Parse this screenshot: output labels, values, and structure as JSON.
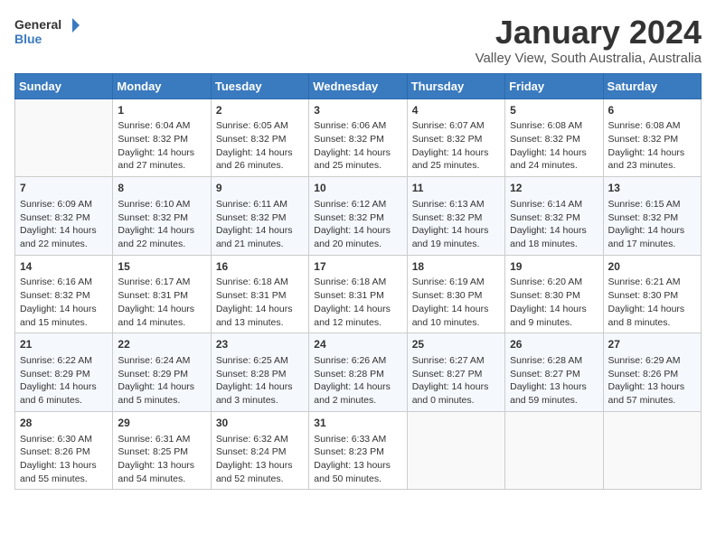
{
  "header": {
    "logo_line1": "General",
    "logo_line2": "Blue",
    "title": "January 2024",
    "subtitle": "Valley View, South Australia, Australia"
  },
  "days_of_week": [
    "Sunday",
    "Monday",
    "Tuesday",
    "Wednesday",
    "Thursday",
    "Friday",
    "Saturday"
  ],
  "weeks": [
    [
      {
        "day": "",
        "info": ""
      },
      {
        "day": "1",
        "info": "Sunrise: 6:04 AM\nSunset: 8:32 PM\nDaylight: 14 hours\nand 27 minutes."
      },
      {
        "day": "2",
        "info": "Sunrise: 6:05 AM\nSunset: 8:32 PM\nDaylight: 14 hours\nand 26 minutes."
      },
      {
        "day": "3",
        "info": "Sunrise: 6:06 AM\nSunset: 8:32 PM\nDaylight: 14 hours\nand 25 minutes."
      },
      {
        "day": "4",
        "info": "Sunrise: 6:07 AM\nSunset: 8:32 PM\nDaylight: 14 hours\nand 25 minutes."
      },
      {
        "day": "5",
        "info": "Sunrise: 6:08 AM\nSunset: 8:32 PM\nDaylight: 14 hours\nand 24 minutes."
      },
      {
        "day": "6",
        "info": "Sunrise: 6:08 AM\nSunset: 8:32 PM\nDaylight: 14 hours\nand 23 minutes."
      }
    ],
    [
      {
        "day": "7",
        "info": "Sunrise: 6:09 AM\nSunset: 8:32 PM\nDaylight: 14 hours\nand 22 minutes."
      },
      {
        "day": "8",
        "info": "Sunrise: 6:10 AM\nSunset: 8:32 PM\nDaylight: 14 hours\nand 22 minutes."
      },
      {
        "day": "9",
        "info": "Sunrise: 6:11 AM\nSunset: 8:32 PM\nDaylight: 14 hours\nand 21 minutes."
      },
      {
        "day": "10",
        "info": "Sunrise: 6:12 AM\nSunset: 8:32 PM\nDaylight: 14 hours\nand 20 minutes."
      },
      {
        "day": "11",
        "info": "Sunrise: 6:13 AM\nSunset: 8:32 PM\nDaylight: 14 hours\nand 19 minutes."
      },
      {
        "day": "12",
        "info": "Sunrise: 6:14 AM\nSunset: 8:32 PM\nDaylight: 14 hours\nand 18 minutes."
      },
      {
        "day": "13",
        "info": "Sunrise: 6:15 AM\nSunset: 8:32 PM\nDaylight: 14 hours\nand 17 minutes."
      }
    ],
    [
      {
        "day": "14",
        "info": "Sunrise: 6:16 AM\nSunset: 8:32 PM\nDaylight: 14 hours\nand 15 minutes."
      },
      {
        "day": "15",
        "info": "Sunrise: 6:17 AM\nSunset: 8:31 PM\nDaylight: 14 hours\nand 14 minutes."
      },
      {
        "day": "16",
        "info": "Sunrise: 6:18 AM\nSunset: 8:31 PM\nDaylight: 14 hours\nand 13 minutes."
      },
      {
        "day": "17",
        "info": "Sunrise: 6:18 AM\nSunset: 8:31 PM\nDaylight: 14 hours\nand 12 minutes."
      },
      {
        "day": "18",
        "info": "Sunrise: 6:19 AM\nSunset: 8:30 PM\nDaylight: 14 hours\nand 10 minutes."
      },
      {
        "day": "19",
        "info": "Sunrise: 6:20 AM\nSunset: 8:30 PM\nDaylight: 14 hours\nand 9 minutes."
      },
      {
        "day": "20",
        "info": "Sunrise: 6:21 AM\nSunset: 8:30 PM\nDaylight: 14 hours\nand 8 minutes."
      }
    ],
    [
      {
        "day": "21",
        "info": "Sunrise: 6:22 AM\nSunset: 8:29 PM\nDaylight: 14 hours\nand 6 minutes."
      },
      {
        "day": "22",
        "info": "Sunrise: 6:24 AM\nSunset: 8:29 PM\nDaylight: 14 hours\nand 5 minutes."
      },
      {
        "day": "23",
        "info": "Sunrise: 6:25 AM\nSunset: 8:28 PM\nDaylight: 14 hours\nand 3 minutes."
      },
      {
        "day": "24",
        "info": "Sunrise: 6:26 AM\nSunset: 8:28 PM\nDaylight: 14 hours\nand 2 minutes."
      },
      {
        "day": "25",
        "info": "Sunrise: 6:27 AM\nSunset: 8:27 PM\nDaylight: 14 hours\nand 0 minutes."
      },
      {
        "day": "26",
        "info": "Sunrise: 6:28 AM\nSunset: 8:27 PM\nDaylight: 13 hours\nand 59 minutes."
      },
      {
        "day": "27",
        "info": "Sunrise: 6:29 AM\nSunset: 8:26 PM\nDaylight: 13 hours\nand 57 minutes."
      }
    ],
    [
      {
        "day": "28",
        "info": "Sunrise: 6:30 AM\nSunset: 8:26 PM\nDaylight: 13 hours\nand 55 minutes."
      },
      {
        "day": "29",
        "info": "Sunrise: 6:31 AM\nSunset: 8:25 PM\nDaylight: 13 hours\nand 54 minutes."
      },
      {
        "day": "30",
        "info": "Sunrise: 6:32 AM\nSunset: 8:24 PM\nDaylight: 13 hours\nand 52 minutes."
      },
      {
        "day": "31",
        "info": "Sunrise: 6:33 AM\nSunset: 8:23 PM\nDaylight: 13 hours\nand 50 minutes."
      },
      {
        "day": "",
        "info": ""
      },
      {
        "day": "",
        "info": ""
      },
      {
        "day": "",
        "info": ""
      }
    ]
  ]
}
